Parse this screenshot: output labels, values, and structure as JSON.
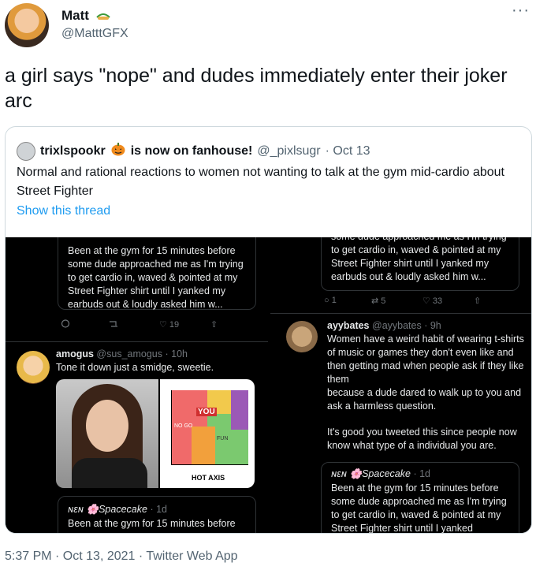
{
  "author": {
    "name": "Matt",
    "handle": "@MatttGFX"
  },
  "more_icon": "···",
  "tweet_text": "a girl says \"nope\" and dudes immediately enter their joker arc",
  "quoted": {
    "name": "trixlspookr",
    "suffix": "is now on fanhouse!",
    "handle": "@_pixlsugr",
    "date": "· Oct 13",
    "text": "Normal and rational reactions to women not wanting to talk at the gym mid-cardio about Street Fighter",
    "show_thread": "Show this thread"
  },
  "media": {
    "left_top_card_text": "Been at the gym for 15 minutes before some dude approached me as I'm trying to get cardio in, waved & pointed at my Street Fighter shirt until I yanked my earbuds out & loudly asked him w...",
    "left_actions": [
      "",
      "",
      "19",
      ""
    ],
    "amogus": {
      "name": "amogus",
      "handle": "@sus_amogus",
      "time": "· 10h",
      "text": "Tone it down just a smidge, sweetie."
    },
    "chart_labels": {
      "axis": "HOT AXIS",
      "you": "YOU",
      "no_go": "NO GO",
      "fun": "FUN"
    },
    "left_bottom_card": {
      "name": "ɴɛɴ 🌸Spacecake",
      "time": "· 1d",
      "text": "Been at the gym for 15 minutes before"
    },
    "right_top_card_text": "some dude approached me as I'm trying to get cardio in, waved & pointed at my Street Fighter shirt until I yanked my earbuds out & loudly asked him w...",
    "right_actions": [
      "1",
      "5",
      "33",
      ""
    ],
    "ayybates": {
      "name": "ayybates",
      "handle": "@ayybates",
      "time": "· 9h",
      "text": "Women have a weird habit of wearing t-shirts of music or games they don't even like and then getting mad when people ask if they like them"
    },
    "right_bottom": {
      "text1": "because a dude dared to walk up to you and ask a harmless question.",
      "text2": "It's good you tweeted this since people now know what type of a individual you are.",
      "card_name": "ɴɛɴ 🌸Spacecake",
      "card_time": "· 1d",
      "card_text": "Been at the gym for 15 minutes before some dude approached me as I'm trying to get cardio in, waved & pointed at my Street Fighter shirt until I yanked"
    }
  },
  "footer": "5:37 PM · Oct 13, 2021 · Twitter Web App"
}
